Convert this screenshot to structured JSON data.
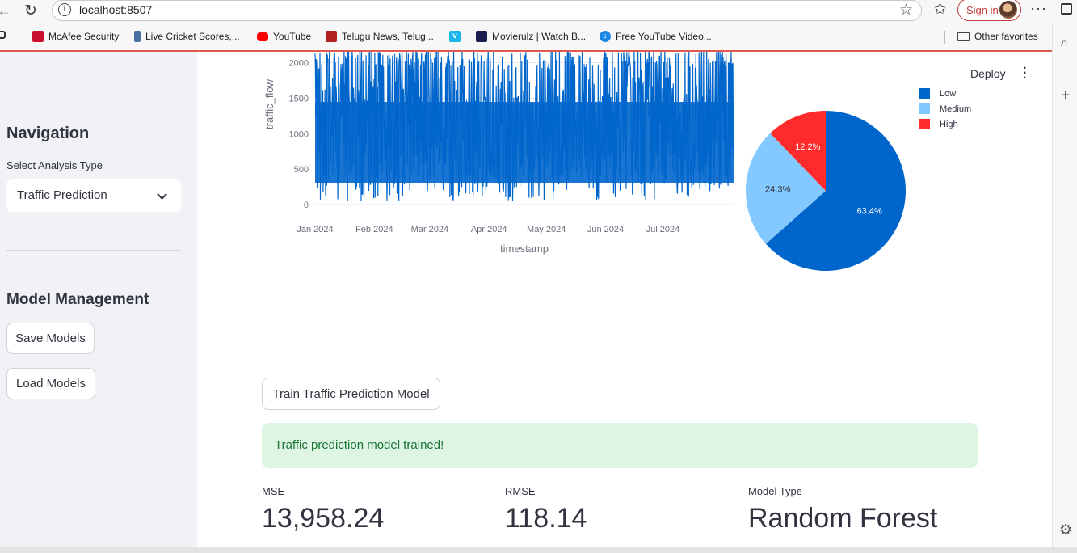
{
  "browser": {
    "url": "localhost:8507",
    "signin_label": "Sign in",
    "more_icon": "more-dots-icon",
    "bookmarks": [
      {
        "label": "McAfee Security",
        "color": "#c8102e"
      },
      {
        "label": "Live Cricket Scores,...",
        "color": "#4a6fa5"
      },
      {
        "label": "YouTube",
        "color": "#ff0000"
      },
      {
        "label": "Telugu News, Telug...",
        "color": "#b22222"
      },
      {
        "label": "",
        "color": "#1ab7ea"
      },
      {
        "label": "Movierulz | Watch B...",
        "color": "#1a1f4f"
      },
      {
        "label": "Free YouTube Video...",
        "color": "#1e88e5"
      }
    ],
    "other_favorites": "Other favorites"
  },
  "sidebar": {
    "nav_title": "Navigation",
    "select_label": "Select Analysis Type",
    "select_value": "Traffic Prediction",
    "model_title": "Model Management",
    "save_button": "Save Models",
    "load_button": "Load Models"
  },
  "header": {
    "deploy_label": "Deploy"
  },
  "chart_data": [
    {
      "type": "line",
      "xlabel": "timestamp",
      "ylabel": "traffic_flow",
      "x_ticks": [
        "Jan 2024",
        "Feb 2024",
        "Mar 2024",
        "Apr 2024",
        "May 2024",
        "Jun 2024",
        "Jul 2024"
      ],
      "y_ticks": [
        0,
        500,
        1000,
        1500,
        2000
      ],
      "ylim": [
        0,
        2200
      ],
      "x_range": [
        "2024-01-01",
        "2024-08-07"
      ],
      "series": [
        {
          "values_min": 50,
          "values_max": 2200,
          "values_typical_low": 400,
          "values_typical_high": 1800
        }
      ],
      "color": "#0066cc",
      "grid": true
    },
    {
      "type": "pie",
      "labels": [
        "Low",
        "Medium",
        "High"
      ],
      "values": [
        63.4,
        24.3,
        12.2
      ],
      "value_labels": [
        "63.4%",
        "24.3%",
        "12.2%"
      ],
      "colors": [
        "#0066cc",
        "#83c9ff",
        "#ff2b2b"
      ],
      "legend_position": "top-right"
    }
  ],
  "main": {
    "train_button": "Train Traffic Prediction Model",
    "success_message": "Traffic prediction model trained!",
    "metrics": [
      {
        "label": "MSE",
        "value": "13,958.24"
      },
      {
        "label": "RMSE",
        "value": "118.14"
      },
      {
        "label": "Model Type",
        "value": "Random Forest"
      }
    ]
  }
}
